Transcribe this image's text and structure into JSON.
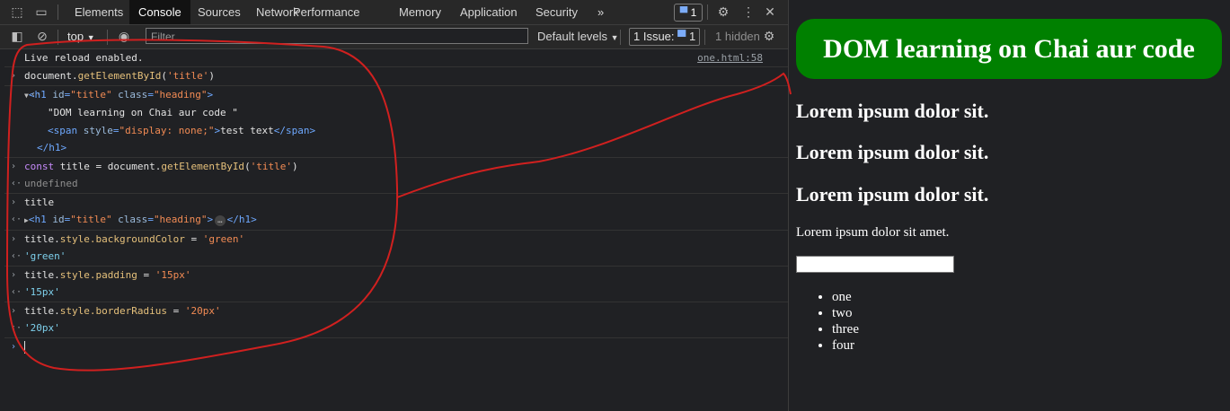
{
  "devtools": {
    "tabs": [
      "Elements",
      "Console",
      "Sources",
      "Network",
      "Performance",
      "Memory",
      "Application",
      "Security"
    ],
    "more_tabs": "»",
    "messages_badge": "1",
    "toolbar": {
      "context": "top",
      "filter_placeholder": "Filter",
      "levels": "Default levels",
      "issues": "1 Issue:",
      "issues_count": "1",
      "hidden": "1 hidden"
    },
    "console": {
      "live_reload": "Live reload enabled.",
      "live_reload_src": "one.html:58",
      "line1": {
        "obj": "document.",
        "method": "getElementById",
        "open": "(",
        "arg": "'title'",
        "close": ")"
      },
      "h1_open": {
        "tag_open": "<h1 ",
        "id_attr": "id",
        "id_val": "\"title\"",
        "class_attr": " class",
        "class_val": "\"heading\"",
        "gt": ">"
      },
      "h1_text": "\"DOM learning on Chai aur code \"",
      "span_line": {
        "tag_open": "<span ",
        "style_attr": "style",
        "style_val": "\"display: none;\"",
        "gt": ">",
        "text": "test text",
        "close": "</span>"
      },
      "h1_close": "</h1>",
      "line2": {
        "kw": "const",
        "var": " title = document.",
        "method": "getElementById",
        "open": "(",
        "arg": "'title'",
        "close": ")"
      },
      "undefined": "undefined",
      "title": "title",
      "h1_collapsed": {
        "tag_open": "<h1 ",
        "id_attr": "id",
        "id_val": "\"title\"",
        "class_attr": " class",
        "class_val": "\"heading\"",
        "gt": ">",
        "ellipsis": "…",
        "close": "</h1>"
      },
      "bg_cmd": {
        "prefix": "title.",
        "prop": "style.backgroundColor",
        "eq": " = ",
        "val": "'green'"
      },
      "bg_result": "'green'",
      "pad_cmd": {
        "prefix": "title.",
        "prop": "style.padding",
        "eq": " = ",
        "val": "'15px'"
      },
      "pad_result": "'15px'",
      "radius_cmd": {
        "prefix": "title.",
        "prop": "style.borderRadius",
        "eq": " = ",
        "val": "'20px'"
      },
      "radius_result": "'20px'"
    }
  },
  "page": {
    "heading": "DOM learning on Chai aur code",
    "lorem_headings": [
      "Lorem ipsum dolor sit.",
      "Lorem ipsum dolor sit.",
      "Lorem ipsum dolor sit."
    ],
    "paragraph": "Lorem ipsum dolor sit amet.",
    "list": [
      "one",
      "two",
      "three",
      "four"
    ]
  },
  "colors": {
    "heading_bg": "#008000",
    "annotation": "#d0201f",
    "devtools_bg": "#202124"
  }
}
